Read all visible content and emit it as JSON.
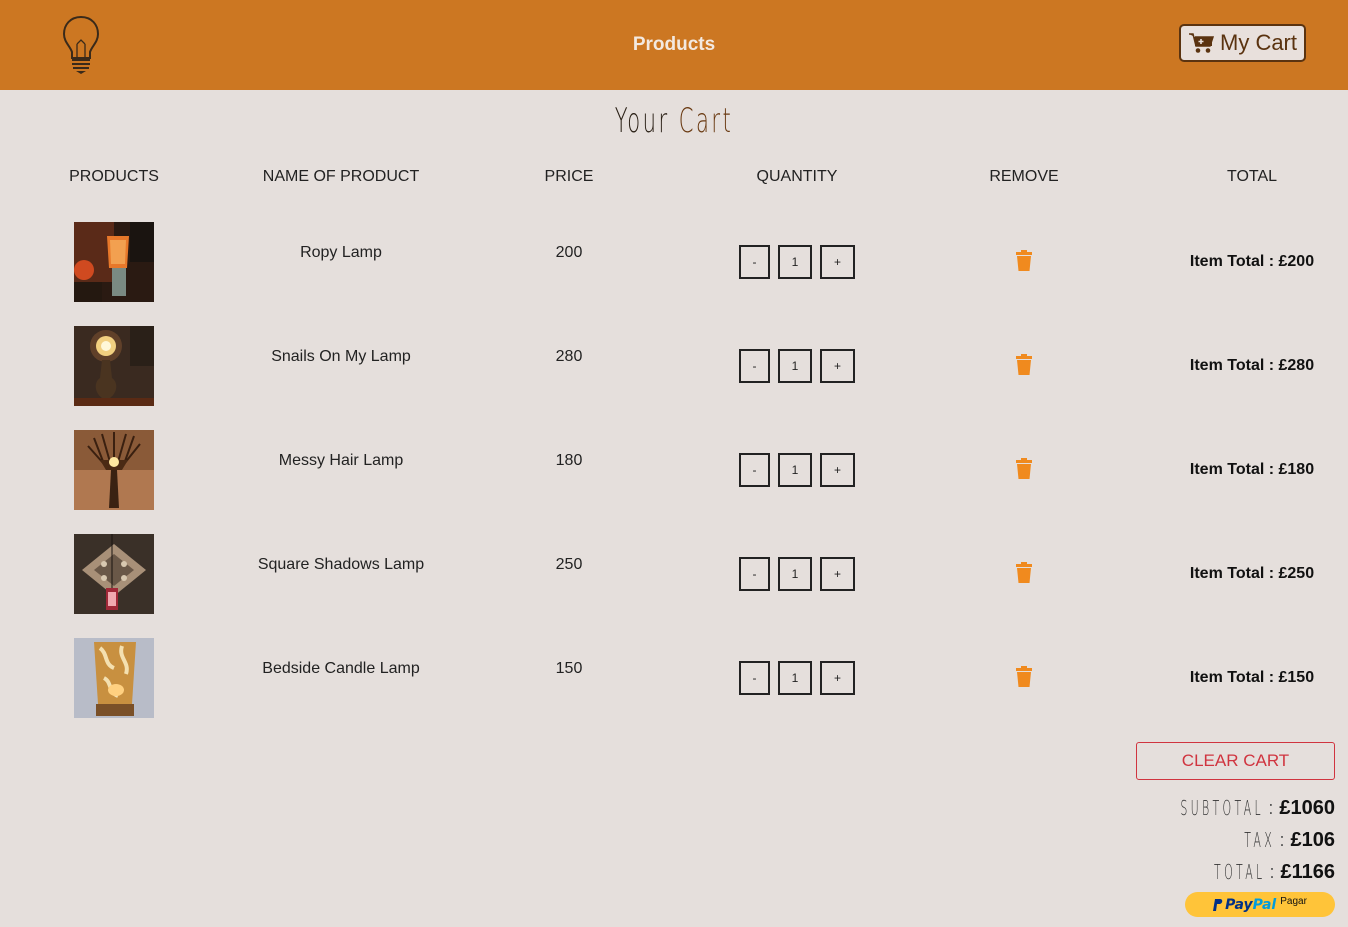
{
  "navbar": {
    "logo_icon": "lightbulb-icon",
    "title": "Products",
    "cart_icon": "shopping-cart-icon",
    "cart_label": "My Cart",
    "background": "#cc7722"
  },
  "heading": {
    "word1": "Your",
    "word2": "Cart"
  },
  "columns": [
    "PRODUCTS",
    "NAME OF PRODUCT",
    "PRICE",
    "QUANTITY",
    "REMOVE",
    "TOTAL"
  ],
  "quantity_controls": {
    "decrement": "-",
    "increment": "+"
  },
  "remove_icon": "trash-icon",
  "items": [
    {
      "name": "Ropy Lamp",
      "price": "200",
      "quantity": "1",
      "total": "Item Total : £200"
    },
    {
      "name": "Snails On My Lamp",
      "price": "280",
      "quantity": "1",
      "total": "Item Total : £280"
    },
    {
      "name": "Messy Hair Lamp",
      "price": "180",
      "quantity": "1",
      "total": "Item Total : £180"
    },
    {
      "name": "Square Shadows Lamp",
      "price": "250",
      "quantity": "1",
      "total": "Item Total : £250"
    },
    {
      "name": "Bedside Candle Lamp",
      "price": "150",
      "quantity": "1",
      "total": "Item Total : £150"
    }
  ],
  "clear_cart_label": "CLEAR CART",
  "summary": {
    "subtotal_label": "SUBTOTAL",
    "subtotal": "£1060",
    "tax_label": "TAX",
    "tax": "£106",
    "total_label": "TOTAL",
    "total": "£1166"
  },
  "paypal": {
    "brand1": "Pay",
    "brand2": "Pal",
    "action": "Pagar"
  },
  "colors": {
    "accent": "#cc7722",
    "danger": "#d0343f",
    "trash": "#f08a1e",
    "paypal": "#ffc439"
  }
}
